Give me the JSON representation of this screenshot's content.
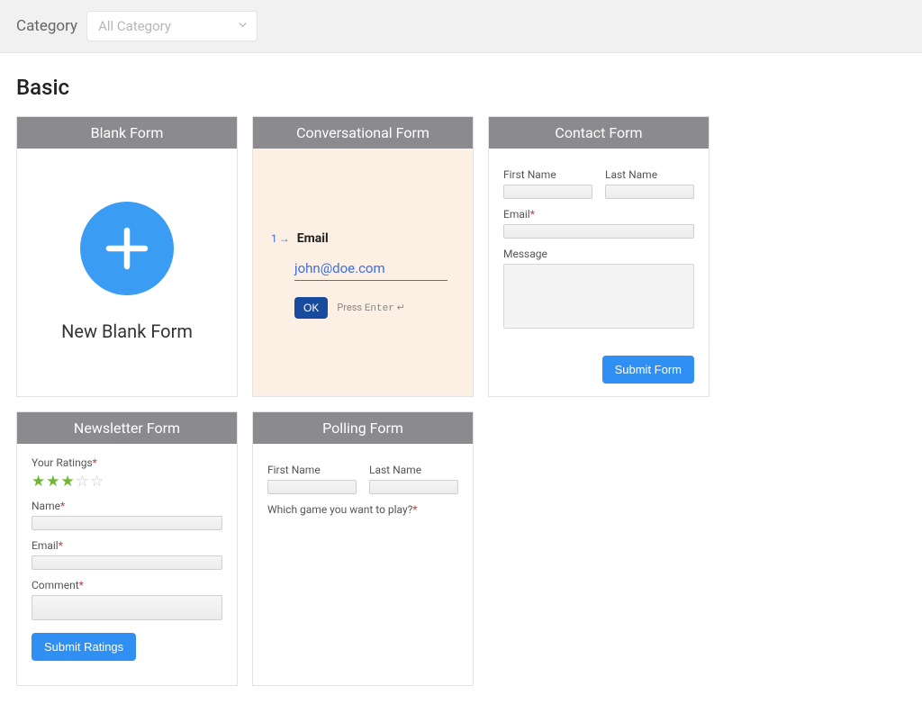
{
  "filter": {
    "label": "Category",
    "placeholder": "All Category"
  },
  "section": {
    "title": "Basic"
  },
  "cards": {
    "blank": {
      "title": "Blank Form",
      "caption": "New Blank Form"
    },
    "conversational": {
      "title": "Conversational Form",
      "step": "1",
      "label": "Email",
      "value": "john@doe.com",
      "ok": "OK",
      "hint_prefix": "Press ",
      "hint_key": "Enter",
      "hint_suffix": " ↵"
    },
    "contact": {
      "title": "Contact Form",
      "first_name": "First Name",
      "last_name": "Last Name",
      "email": "Email",
      "message": "Message",
      "submit": "Submit Form"
    },
    "newsletter": {
      "title": "Newsletter Form",
      "ratings_label": "Your Ratings",
      "stars_on": 3,
      "stars_total": 5,
      "name": "Name",
      "email": "Email",
      "comment": "Comment",
      "submit": "Submit Ratings"
    },
    "polling": {
      "title": "Polling Form",
      "first_name": "First Name",
      "last_name": "Last Name",
      "question": "Which game you want to play?"
    }
  }
}
